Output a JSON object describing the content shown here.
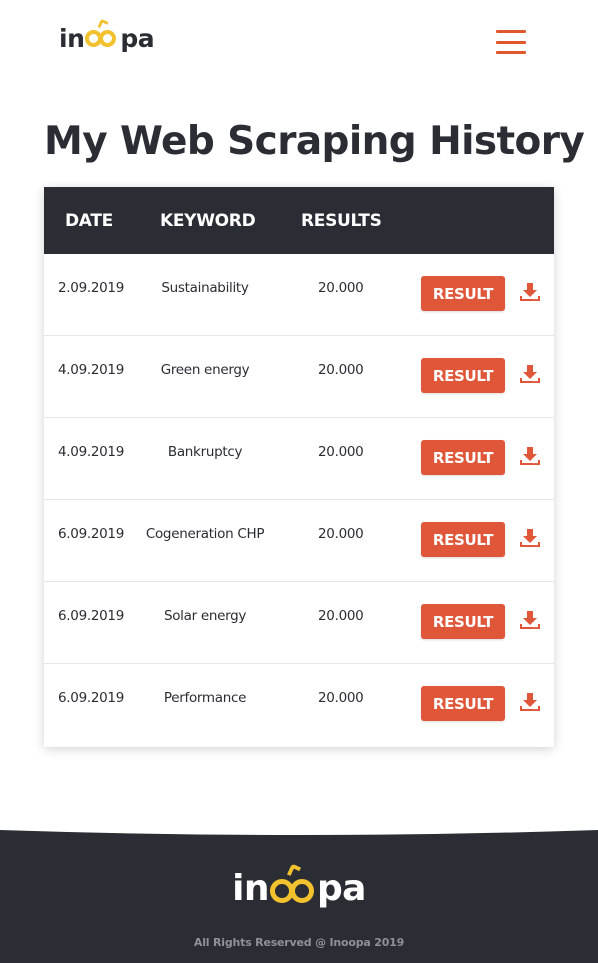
{
  "header": {
    "logo_prefix": "in",
    "logo_suffix": "pa",
    "menu_icon": "hamburger-menu-icon"
  },
  "page_title": "My Web Scraping History",
  "table": {
    "columns": [
      "DATE",
      "KEYWORD",
      "RESULTS"
    ],
    "rows": [
      {
        "date": "2.09.2019",
        "keyword": "Sustainability",
        "results": "20.000",
        "button": "RESULT"
      },
      {
        "date": "4.09.2019",
        "keyword": "Green energy",
        "results": "20.000",
        "button": "RESULT"
      },
      {
        "date": "4.09.2019",
        "keyword": "Bankruptcy",
        "results": "20.000",
        "button": "RESULT"
      },
      {
        "date": "6.09.2019",
        "keyword": "Cogeneration CHP",
        "results": "20.000",
        "button": "RESULT"
      },
      {
        "date": "6.09.2019",
        "keyword": "Solar energy",
        "results": "20.000",
        "button": "RESULT"
      },
      {
        "date": "6.09.2019",
        "keyword": "Performance",
        "results": "20.000",
        "button": "RESULT"
      }
    ],
    "download_icon": "download-icon"
  },
  "footer": {
    "logo_prefix": "in",
    "logo_suffix": "pa",
    "copyright": "All Rights Reserved @ Inoopa 2019"
  },
  "colors": {
    "accent": "#df5639",
    "dark": "#2a2d33",
    "logo_yellow": "#f2c12e"
  }
}
